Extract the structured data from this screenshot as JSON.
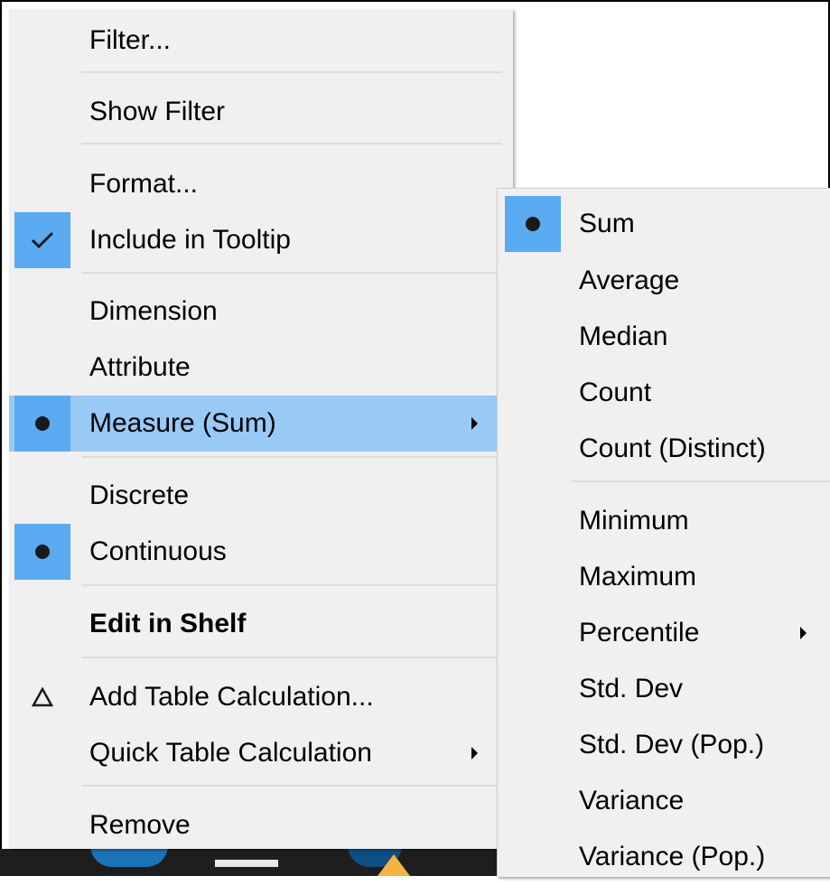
{
  "main_menu": {
    "filter": "Filter...",
    "show_filter": "Show Filter",
    "format": "Format...",
    "include_tooltip": "Include in Tooltip",
    "dimension": "Dimension",
    "attribute": "Attribute",
    "measure": "Measure (Sum)",
    "discrete": "Discrete",
    "continuous": "Continuous",
    "edit_in_shelf": "Edit in Shelf",
    "add_table_calc": "Add Table Calculation...",
    "quick_table_calc": "Quick Table Calculation",
    "remove": "Remove"
  },
  "sub_menu": {
    "sum": "Sum",
    "average": "Average",
    "median": "Median",
    "count": "Count",
    "count_distinct": "Count (Distinct)",
    "minimum": "Minimum",
    "maximum": "Maximum",
    "percentile": "Percentile",
    "std_dev": "Std. Dev",
    "std_dev_pop": "Std. Dev (Pop.)",
    "variance": "Variance",
    "variance_pop": "Variance (Pop.)"
  },
  "icons": {
    "tooltip": "checkmark-icon",
    "measure": "radio-dot-icon",
    "continuous": "radio-dot-icon",
    "add_table_calc": "delta-icon",
    "sum": "radio-dot-icon"
  },
  "colors": {
    "menu_bg": "#f0f0f0",
    "highlight": "#99c9f5",
    "check_bg": "#5aabf2"
  }
}
